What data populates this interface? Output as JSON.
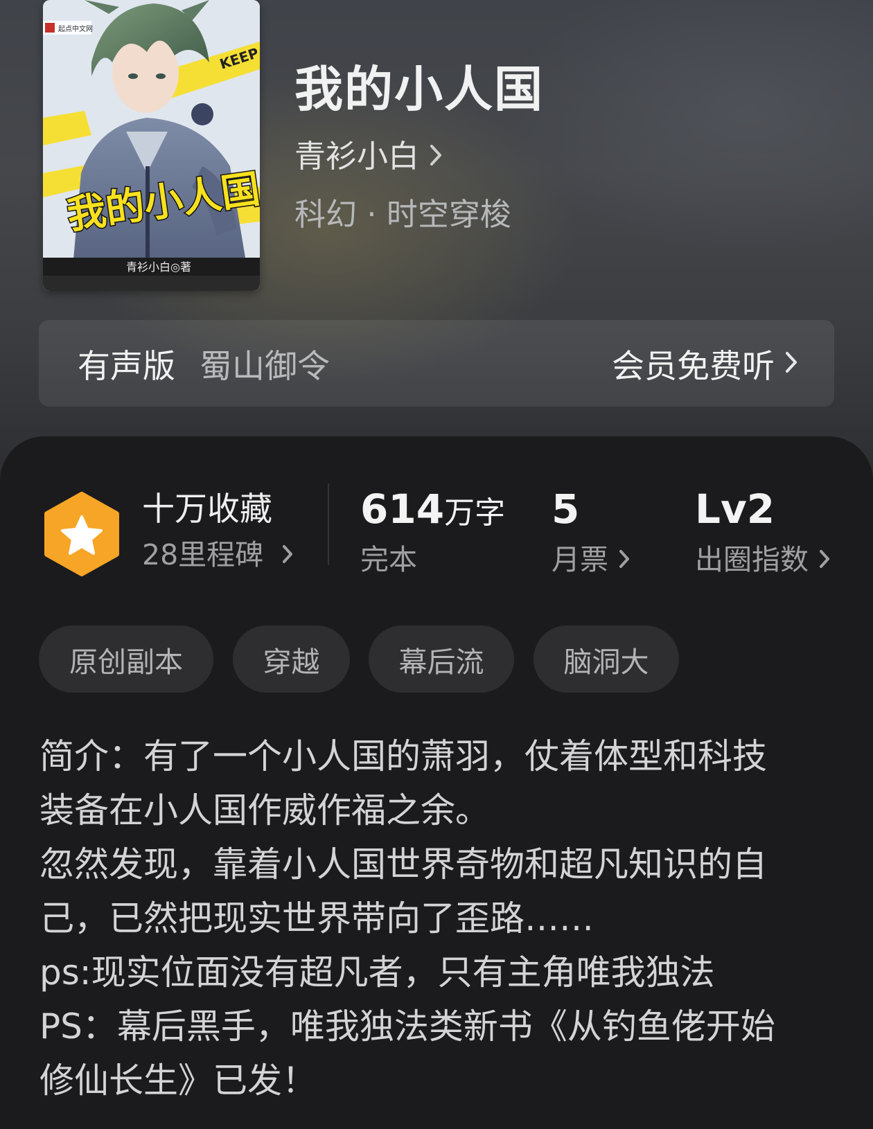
{
  "book": {
    "title": "我的小人国",
    "author": "青衫小白",
    "genre": "科幻 · 时空穿梭"
  },
  "cover": {
    "publisher": "起点中文网",
    "title_text": "我的小人国",
    "author_text": "青衫小白◎著",
    "tape_text": "KEEP OUT"
  },
  "audio": {
    "label": "有声版",
    "reader": "蜀山御令",
    "action": "会员免费听"
  },
  "stats": {
    "collect_title": "十万收藏",
    "collect_sub": "28里程碑",
    "words_value": "614",
    "words_unit": "万字",
    "words_label": "完本",
    "tickets_value": "5",
    "tickets_label": "月票",
    "level_value": "Lv2",
    "level_label": "出圈指数"
  },
  "tags": [
    "原创副本",
    "穿越",
    "幕后流",
    "脑洞大"
  ],
  "intro_lines": [
    "简介：有了一个小人国的萧羽，仗着体型和科技",
    "装备在小人国作威作福之余。",
    "忽然发现，靠着小人国世界奇物和超凡知识的自",
    "己，已然把现实世界带向了歪路……",
    "ps:现实位面没有超凡者，只有主角唯我独法",
    "PS：幕后黑手，唯我独法类新书《从钓鱼佬开始",
    "修仙长生》已发！"
  ],
  "colors": {
    "badge_gold": "#f7a526",
    "panel_bg": "#1b1b1d",
    "tag_bg": "#2e2e31"
  },
  "icons": {
    "badge": "star-hexagon-icon",
    "chevron": "chevron-right-icon"
  }
}
